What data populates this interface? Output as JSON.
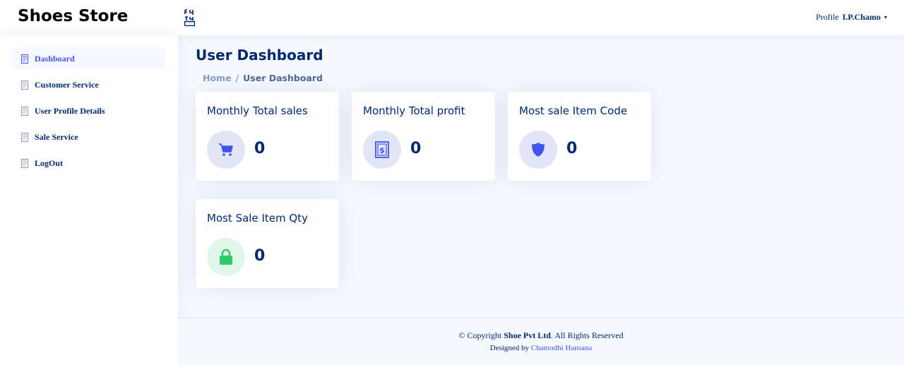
{
  "header": {
    "brand": "Shoes Store",
    "toggle_icon": "toggle-sidebar-icon",
    "profile_prefix": "Profile",
    "profile_user": "I.P.Chamo",
    "caret": "▾"
  },
  "sidebar": {
    "items": [
      {
        "label": "Dashboard",
        "icon": "document-icon",
        "active": true
      },
      {
        "label": "Customer Service",
        "icon": "document-icon"
      },
      {
        "label": "User Profile Details",
        "icon": "document-icon"
      },
      {
        "label": "Sale Service",
        "icon": "document-icon"
      },
      {
        "label": "LogOut",
        "icon": "document-icon"
      }
    ]
  },
  "main": {
    "title": "User Dashboard",
    "breadcrumb": {
      "home": "Home",
      "separator": "/",
      "current": "User Dashboard"
    },
    "cards": [
      {
        "title": "Monthly Total sales",
        "value": "0",
        "icon": "cart-icon",
        "icon_bg": "#e0e6f6",
        "icon_color": "#4154f1"
      },
      {
        "title": "Monthly Total profit",
        "value": "0",
        "icon": "dollar-receipt-icon",
        "icon_bg": "#e0e6f6",
        "icon_color": "#4154f1"
      },
      {
        "title": "Most sale Item Code",
        "value": "0",
        "icon": "shield-icon",
        "icon_bg": "#e0e6f6",
        "icon_color": "#4154f1"
      },
      {
        "title": "Most Sale Item Qty",
        "value": "0",
        "icon": "lock-icon",
        "icon_bg": "#e0f8e9",
        "icon_color": "#2eca6a"
      }
    ]
  },
  "footer": {
    "copyright_prefix": "© Copyright",
    "company": "Shoe Pvt Ltd",
    "copyright_suffix": ". All Rights Reserved",
    "designed_by": "Designed by",
    "designer": "Chamodhi Hansana"
  },
  "colors": {
    "primary": "#012970",
    "accent": "#4154f1",
    "background": "#f6f9ff"
  }
}
